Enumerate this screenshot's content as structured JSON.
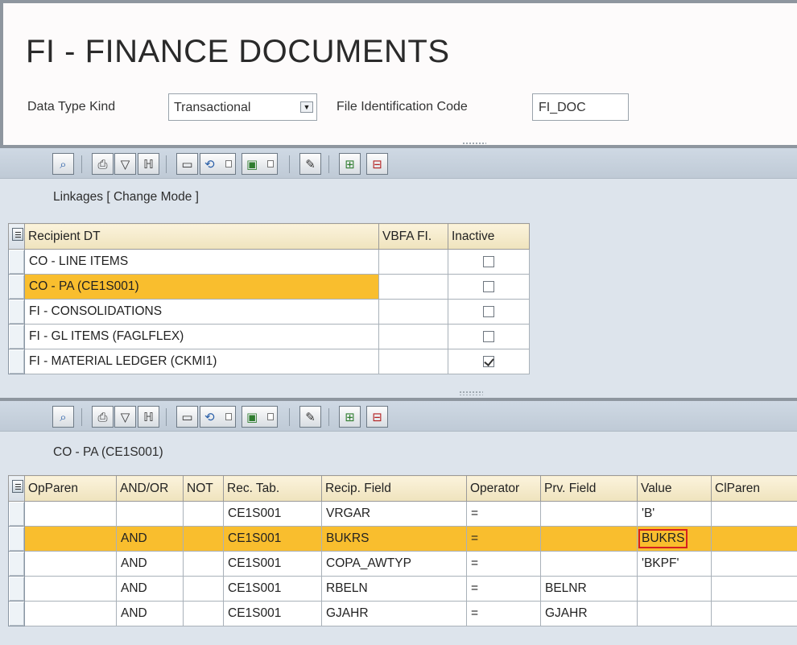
{
  "header": {
    "title": "FI - FINANCE DOCUMENTS",
    "data_type_kind_label": "Data Type Kind",
    "data_type_kind_value": "Transactional",
    "file_id_label": "File Identification Code",
    "file_id_value": "FI_DOC"
  },
  "toolbar_icons": [
    "details-icon",
    "print-icon",
    "filter-icon",
    "find-icon",
    "print-preview-icon",
    "export-icon",
    "layout-icon",
    "clear-icon",
    "insert-row-icon",
    "delete-row-icon"
  ],
  "linkages": {
    "title": "Linkages [ Change Mode ]",
    "columns": [
      "Recipient DT",
      "VBFA FI.",
      "Inactive"
    ],
    "rows": [
      {
        "recipient": "CO - LINE ITEMS",
        "vbfa": "",
        "inactive": false
      },
      {
        "recipient": "CO - PA (CE1S001)",
        "vbfa": "",
        "inactive": false,
        "selected": true
      },
      {
        "recipient": "FI - CONSOLIDATIONS",
        "vbfa": "",
        "inactive": false
      },
      {
        "recipient": "FI - GL ITEMS (FAGLFLEX)",
        "vbfa": "",
        "inactive": false
      },
      {
        "recipient": "FI - MATERIAL LEDGER (CKMI1)",
        "vbfa": "",
        "inactive": true
      }
    ]
  },
  "conditions": {
    "title": "CO - PA (CE1S001)",
    "columns": [
      "OpParen",
      "AND/OR",
      "NOT",
      "Rec. Tab.",
      "Recip. Field",
      "Operator",
      "Prv. Field",
      "Value",
      "ClParen"
    ],
    "rows": [
      {
        "op": "",
        "andor": "",
        "not": "",
        "rectab": "CE1S001",
        "field": "VRGAR",
        "operator": "=",
        "prv": "",
        "value": "'B'",
        "cl": ""
      },
      {
        "op": "",
        "andor": "AND",
        "not": "",
        "rectab": "CE1S001",
        "field": "BUKRS",
        "operator": "=",
        "prv": "",
        "value": "BUKRS",
        "cl": "",
        "selected": true
      },
      {
        "op": "",
        "andor": "AND",
        "not": "",
        "rectab": "CE1S001",
        "field": "COPA_AWTYP",
        "operator": "=",
        "prv": "",
        "value": "'BKPF'",
        "cl": ""
      },
      {
        "op": "",
        "andor": "AND",
        "not": "",
        "rectab": "CE1S001",
        "field": "RBELN",
        "operator": "=",
        "prv": "BELNR",
        "value": "",
        "cl": ""
      },
      {
        "op": "",
        "andor": "AND",
        "not": "",
        "rectab": "CE1S001",
        "field": "GJAHR",
        "operator": "=",
        "prv": "GJAHR",
        "value": "",
        "cl": ""
      }
    ]
  },
  "colors": {
    "highlight": "#f9be2e",
    "value_outline": "#d62020",
    "pane_bg": "#dde4ec"
  }
}
